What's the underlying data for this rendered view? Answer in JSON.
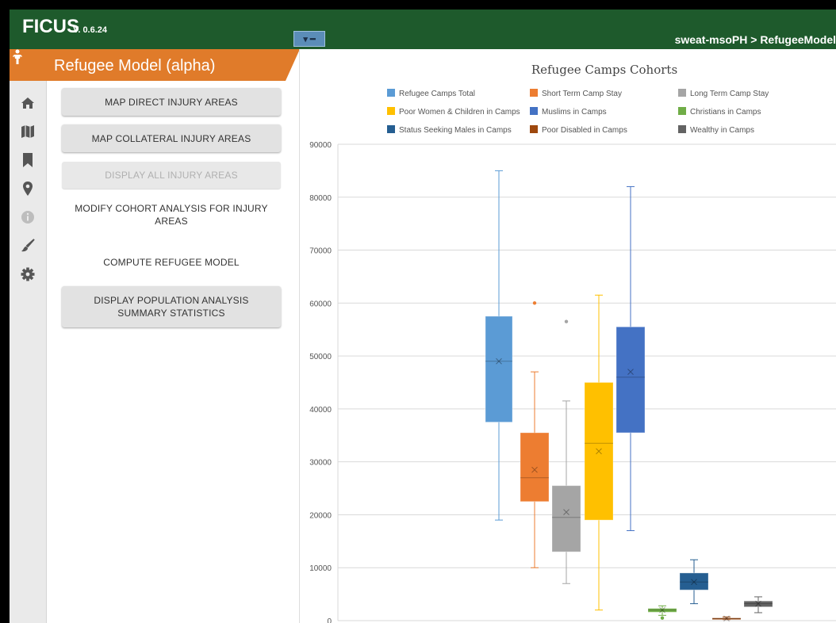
{
  "app": {
    "title": "FICUS",
    "version": "V. 0.6.24",
    "breadcrumb": "sweat-msoPH > RefugeeModel"
  },
  "panel": {
    "title": "Refugee Model (alpha)",
    "buttons": [
      {
        "label": "MAP DIRECT INJURY AREAS"
      },
      {
        "label": "MAP COLLATERAL INJURY AREAS"
      },
      {
        "label": "DISPLAY ALL INJURY AREAS"
      },
      {
        "label": "MODIFY COHORT ANALYSIS FOR INJURY AREAS"
      },
      {
        "label": "COMPUTE REFUGEE MODEL"
      },
      {
        "label": "DISPLAY POPULATION ANALYSIS SUMMARY STATISTICS"
      }
    ]
  },
  "rail_icons": [
    "home-icon",
    "map-icon",
    "bookmark-icon",
    "map-pin-icon",
    "info-icon",
    "brush-icon",
    "gear-icon"
  ],
  "colors": {
    "topbar": "#1e5a2c",
    "accent": "#e07b2a"
  },
  "chart_data": {
    "type": "boxplot",
    "title": "Refugee Camps Cohorts",
    "ylim": [
      0,
      90000
    ],
    "yticks": [
      "0",
      "10000",
      "20000",
      "30000",
      "40000",
      "50000",
      "60000",
      "70000",
      "80000",
      "90000"
    ],
    "grid": true,
    "legend_position": "top",
    "series": [
      {
        "name": "Refugee Camps Total",
        "color": "#5b9bd5",
        "min": 19000,
        "q1": 37500,
        "median": 49000,
        "mean": 49000,
        "q3": 57500,
        "max": 85000,
        "outliers": []
      },
      {
        "name": "Short Term Camp Stay",
        "color": "#ed7d31",
        "min": 10000,
        "q1": 22500,
        "median": 27000,
        "mean": 28500,
        "q3": 35500,
        "max": 47000,
        "outliers": [
          60000
        ]
      },
      {
        "name": "Long Term Camp Stay",
        "color": "#a5a5a5",
        "min": 7000,
        "q1": 13000,
        "median": 19500,
        "mean": 20500,
        "q3": 25500,
        "max": 41500,
        "outliers": [
          56500
        ]
      },
      {
        "name": "Poor Women & Children in Camps",
        "color": "#ffc000",
        "min": 2000,
        "q1": 19000,
        "median": 33500,
        "mean": 32000,
        "q3": 45000,
        "max": 61500,
        "outliers": []
      },
      {
        "name": "Muslims in Camps",
        "color": "#4472c4",
        "min": 17000,
        "q1": 35500,
        "median": 46000,
        "mean": 47000,
        "q3": 55500,
        "max": 82000,
        "outliers": []
      },
      {
        "name": "Christians in Camps",
        "color": "#70ad47",
        "min": 1000,
        "q1": 1600,
        "median": 2000,
        "mean": 2000,
        "q3": 2300,
        "max": 2800,
        "outliers": [
          500
        ]
      },
      {
        "name": "Status Seeking Males in Camps",
        "color": "#255e91",
        "min": 3200,
        "q1": 5800,
        "median": 7300,
        "mean": 7300,
        "q3": 9000,
        "max": 11500,
        "outliers": []
      },
      {
        "name": "Poor Disabled in Camps",
        "color": "#9e480e",
        "min": 200,
        "q1": 300,
        "median": 400,
        "mean": 400,
        "q3": 500,
        "max": 700,
        "outliers": []
      },
      {
        "name": "Wealthy in Camps",
        "color": "#636363",
        "min": 1500,
        "q1": 2600,
        "median": 3200,
        "mean": 3200,
        "q3": 3700,
        "max": 4500,
        "outliers": []
      }
    ]
  }
}
